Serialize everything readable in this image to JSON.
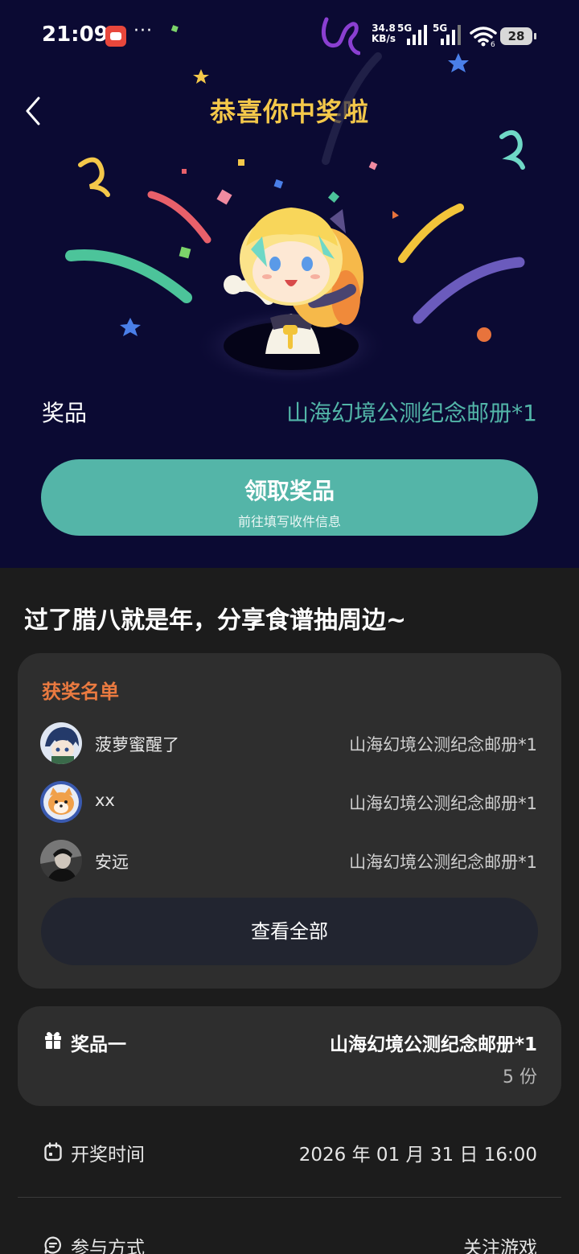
{
  "status_bar": {
    "time": "21:09",
    "more": "···",
    "net_speed_value": "34.8",
    "net_speed_unit": "KB/s",
    "signal1_label": "5G",
    "signal2_label": "5G",
    "wifi_suffix": "6",
    "battery": "28"
  },
  "header": {
    "title": "恭喜你中奖啦"
  },
  "prize": {
    "label": "奖品",
    "value": "山海幻境公测纪念邮册*1"
  },
  "claim": {
    "title": "领取奖品",
    "subtitle": "前往填写收件信息"
  },
  "activity": {
    "title": "过了腊八就是年，分享食谱抽周边~"
  },
  "winners": {
    "heading": "获奖名单",
    "items": [
      {
        "name": "菠萝蜜醒了",
        "prize": "山海幻境公测纪念邮册*1"
      },
      {
        "name": "xx",
        "prize": "山海幻境公测纪念邮册*1"
      },
      {
        "name": "安远",
        "prize": "山海幻境公测纪念邮册*1"
      }
    ],
    "view_all": "查看全部"
  },
  "prize_detail": {
    "label": "奖品一",
    "name": "山海幻境公测纪念邮册*1",
    "quantity": "5 份"
  },
  "draw_time": {
    "label": "开奖时间",
    "value": "2026 年 01 月 31 日 16:00"
  },
  "participation": {
    "label": "参与方式",
    "value": "关注游戏"
  },
  "colors": {
    "hero_bg": "#0b0a33",
    "accent_teal": "#54b5a8",
    "title_gold": "#f4c84a",
    "winners_orange": "#ea7a40",
    "card_bg": "#2e2e2e"
  },
  "icons": [
    "back-icon",
    "gift-icon",
    "calendar-icon",
    "chat-icon",
    "wifi-icon",
    "battery-icon"
  ]
}
